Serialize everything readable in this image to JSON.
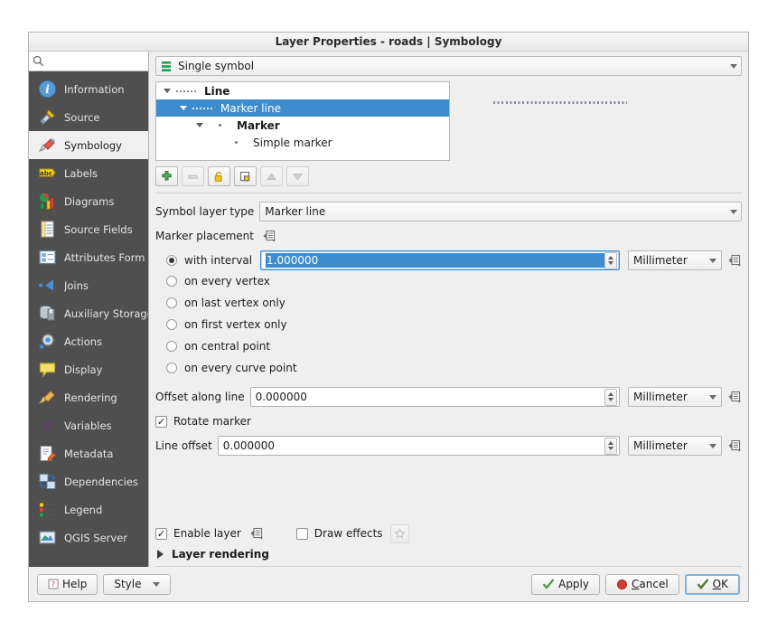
{
  "dialog": {
    "title": "Layer Properties - roads | Symbology"
  },
  "sidebar": {
    "search": {
      "placeholder": "",
      "value": ""
    },
    "items": [
      {
        "label": "Information",
        "icon": "information-icon",
        "active": false
      },
      {
        "label": "Source",
        "icon": "source-icon",
        "active": false
      },
      {
        "label": "Symbology",
        "icon": "symbology-brush-icon",
        "active": true
      },
      {
        "label": "Labels",
        "icon": "labels-abc-icon",
        "active": false
      },
      {
        "label": "Diagrams",
        "icon": "diagrams-chart-icon",
        "active": false
      },
      {
        "label": "Source Fields",
        "icon": "source-fields-icon",
        "active": false
      },
      {
        "label": "Attributes Form",
        "icon": "attributes-form-icon",
        "active": false
      },
      {
        "label": "Joins",
        "icon": "joins-icon",
        "active": false
      },
      {
        "label": "Auxiliary Storage",
        "icon": "auxiliary-storage-icon",
        "active": false
      },
      {
        "label": "Actions",
        "icon": "actions-gear-icon",
        "active": false
      },
      {
        "label": "Display",
        "icon": "display-balloon-icon",
        "active": false
      },
      {
        "label": "Rendering",
        "icon": "rendering-brush-icon",
        "active": false
      },
      {
        "label": "Variables",
        "icon": "variables-epsilon-icon",
        "active": false
      },
      {
        "label": "Metadata",
        "icon": "metadata-pencil-icon",
        "active": false
      },
      {
        "label": "Dependencies",
        "icon": "dependencies-icon",
        "active": false
      },
      {
        "label": "Legend",
        "icon": "legend-icon",
        "active": false
      },
      {
        "label": "QGIS Server",
        "icon": "qgis-server-icon",
        "active": false
      }
    ]
  },
  "renderer": {
    "label": "Single symbol",
    "icon": "single-symbol-icon"
  },
  "symbol_tree": {
    "nodes": [
      {
        "label": "Line",
        "indent": 0,
        "bold": true,
        "selected": false,
        "expander": true,
        "swatch": "dashed-line"
      },
      {
        "label": "Marker line",
        "indent": 1,
        "bold": false,
        "selected": true,
        "expander": true,
        "swatch": "dashed-line"
      },
      {
        "label": "Marker",
        "indent": 2,
        "bold": true,
        "selected": false,
        "expander": true,
        "swatch": "dot"
      },
      {
        "label": "Simple marker",
        "indent": 3,
        "bold": false,
        "selected": false,
        "expander": false,
        "swatch": "dot"
      }
    ]
  },
  "layer_toolbar": {
    "buttons": [
      {
        "name": "add-symbol-layer-button",
        "icon": "plus-icon",
        "enabled": true
      },
      {
        "name": "remove-symbol-layer-button",
        "icon": "minus-icon",
        "enabled": false
      },
      {
        "name": "lock-layer-colors-button",
        "icon": "padlock-icon",
        "enabled": true
      },
      {
        "name": "duplicate-symbol-layer-button",
        "icon": "copy-icon",
        "enabled": true
      },
      {
        "name": "move-layer-up-button",
        "icon": "arrow-up-icon",
        "enabled": false
      },
      {
        "name": "move-layer-down-button",
        "icon": "arrow-down-icon",
        "enabled": false
      }
    ]
  },
  "form": {
    "symbol_layer_type": {
      "label": "Symbol layer type",
      "value": "Marker line"
    },
    "marker_placement": {
      "label": "Marker placement",
      "interval": {
        "radio_label": "with interval",
        "selected": true,
        "value": "1.000000",
        "unit": "Millimeter"
      },
      "options": [
        {
          "label": "on every vertex",
          "selected": false
        },
        {
          "label": "on last vertex only",
          "selected": false
        },
        {
          "label": "on first vertex only",
          "selected": false
        },
        {
          "label": "on central point",
          "selected": false
        },
        {
          "label": "on every curve point",
          "selected": false
        }
      ]
    },
    "offset_along_line": {
      "label": "Offset along line",
      "value": "0.000000",
      "unit": "Millimeter"
    },
    "rotate_marker": {
      "label": "Rotate marker",
      "checked": true,
      "mark": "✓"
    },
    "line_offset": {
      "label": "Line offset",
      "value": "0.000000",
      "unit": "Millimeter"
    }
  },
  "bottom": {
    "enable_layer": {
      "label": "Enable layer",
      "checked": true,
      "mark": "✓"
    },
    "draw_effects": {
      "label": "Draw effects",
      "checked": false,
      "mark": ""
    },
    "layer_rendering": {
      "label": "Layer rendering"
    }
  },
  "buttons": {
    "help": {
      "label": "Help",
      "icon": "help-icon"
    },
    "style": {
      "label": "Style"
    },
    "apply": {
      "label": "Apply",
      "icon": "check-icon"
    },
    "cancel": {
      "label": "Cancel",
      "icon": "cancel-icon",
      "underline": "C",
      "rest": "ancel"
    },
    "ok": {
      "label": "OK",
      "icon": "ok-icon",
      "underline": "O",
      "rest": "K"
    }
  },
  "colors": {
    "selection_blue": "#3d8dce",
    "sidebar_bg": "#4f4f4f",
    "dialog_bg": "#efefef"
  }
}
